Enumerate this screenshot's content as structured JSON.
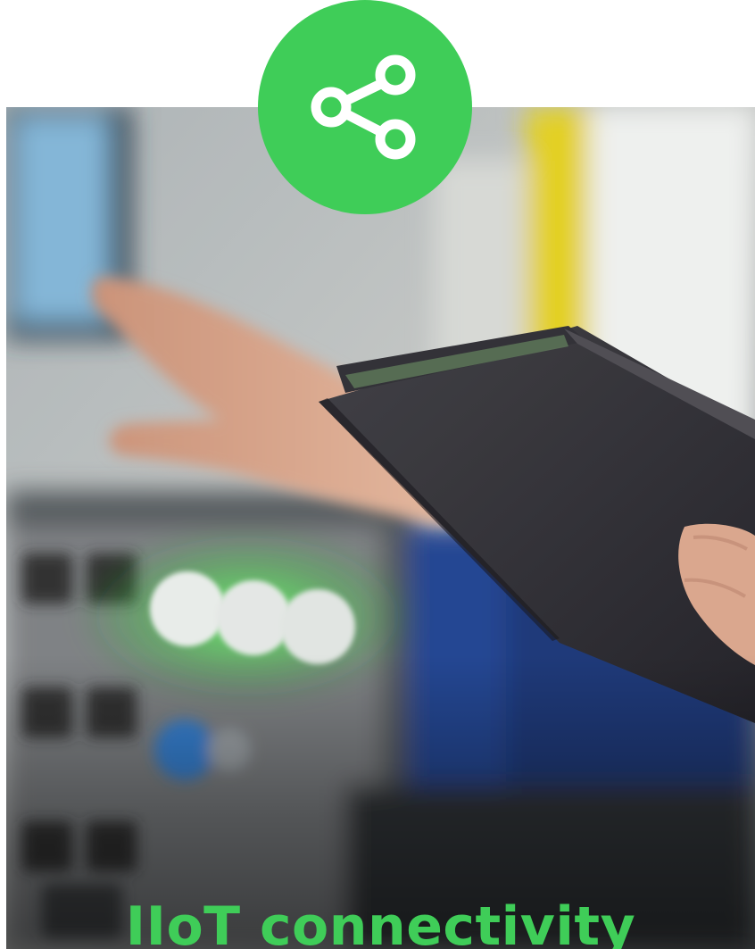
{
  "tile": {
    "title": "IIoT connectivity",
    "icon": "share-icon",
    "accent_color": "#3fcd58",
    "photo_subject": "photo-operator-control-panel"
  }
}
